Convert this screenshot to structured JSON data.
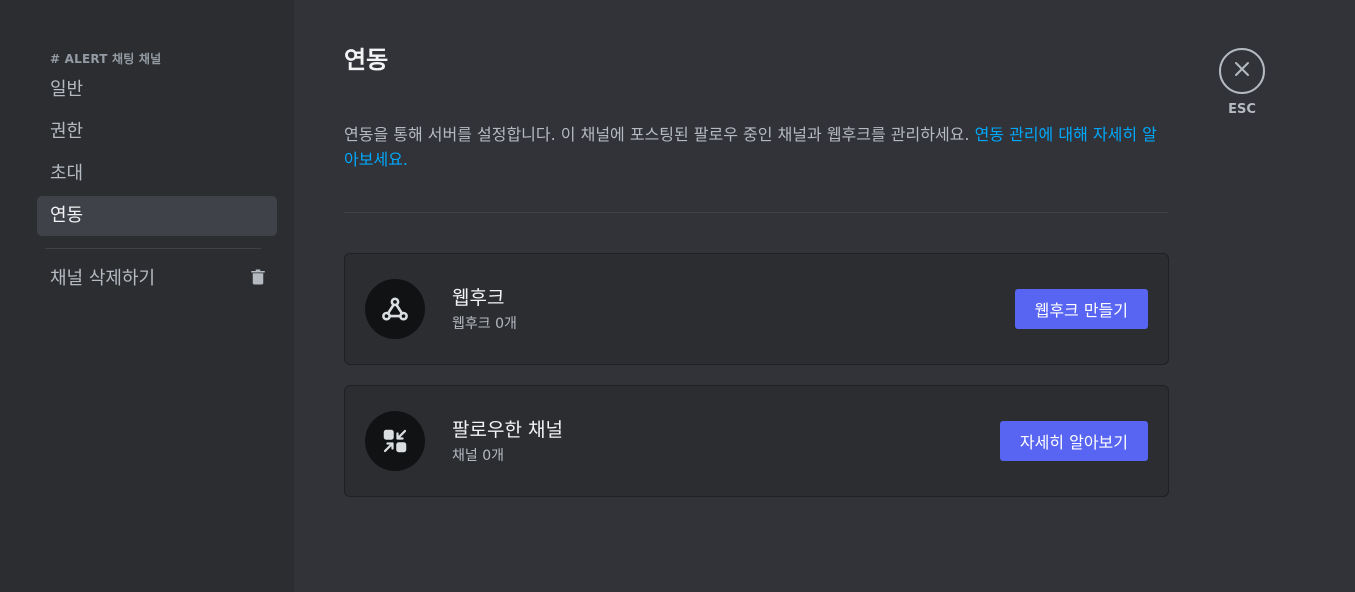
{
  "sidebar": {
    "header": "# ALERT 채팅 채널",
    "items": [
      {
        "label": "일반"
      },
      {
        "label": "권한"
      },
      {
        "label": "초대"
      },
      {
        "label": "연동"
      }
    ],
    "active_index": 3,
    "delete_label": "채널 삭제하기"
  },
  "main": {
    "title": "연동",
    "description": "연동을 통해 서버를 설정합니다. 이 채널에 포스팅된 팔로우 중인 채널과 웹후크를 관리하세요.",
    "description_link": "연동 관리에 대해 자세히 알아보세요.",
    "cards": [
      {
        "title": "웹후크",
        "subtitle": "웹후크 0개",
        "button": "웹후크 만들기",
        "icon": "webhook-icon"
      },
      {
        "title": "팔로우한 채널",
        "subtitle": "채널 0개",
        "button": "자세히 알아보기",
        "icon": "followed-channels-icon"
      }
    ]
  },
  "esc": {
    "label": "ESC"
  },
  "colors": {
    "accent": "#5865f2",
    "link": "#00a8fc",
    "sidebar_bg": "#2b2d31",
    "main_bg": "#313338"
  }
}
